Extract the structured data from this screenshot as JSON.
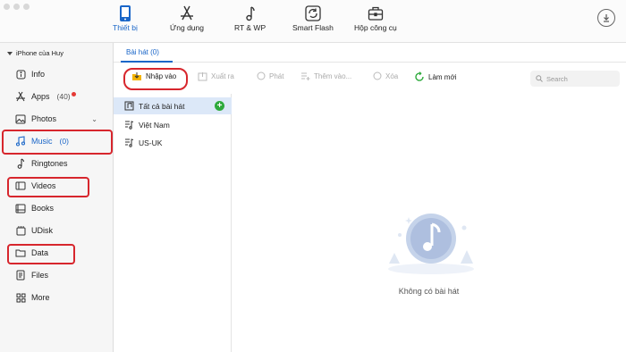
{
  "toolbar": {
    "items": [
      {
        "label": "Thiết bị",
        "icon": "phone-icon",
        "active": true
      },
      {
        "label": "Ứng dụng",
        "icon": "app-store-icon",
        "active": false
      },
      {
        "label": "RT & WP",
        "icon": "music-note-icon",
        "active": false
      },
      {
        "label": "Smart Flash",
        "icon": "refresh-icon",
        "active": false
      },
      {
        "label": "Hộp công cụ",
        "icon": "toolbox-icon",
        "active": false
      }
    ],
    "download_icon": "download-icon"
  },
  "sidebar": {
    "device_name": "iPhone của Huy",
    "items": [
      {
        "label": "Info",
        "icon": "info-icon"
      },
      {
        "label": "Apps",
        "count": "(40)",
        "icon": "apps-icon"
      },
      {
        "label": "Photos",
        "icon": "photos-icon"
      },
      {
        "label": "Music",
        "count": "(0)",
        "icon": "music-icon"
      },
      {
        "label": "Ringtones",
        "icon": "ringtone-icon"
      },
      {
        "label": "Videos",
        "icon": "video-icon"
      },
      {
        "label": "Books",
        "icon": "books-icon"
      },
      {
        "label": "UDisk",
        "icon": "udisk-icon"
      },
      {
        "label": "Data",
        "icon": "folder-icon"
      },
      {
        "label": "Files",
        "icon": "files-icon"
      },
      {
        "label": "More",
        "icon": "more-icon"
      }
    ]
  },
  "tabs": [
    {
      "label": "Bài hát (0)"
    }
  ],
  "actions": [
    {
      "label": "Nhập vào",
      "icon": "import-icon",
      "enabled": true
    },
    {
      "label": "Xuất ra",
      "icon": "export-icon",
      "enabled": false
    },
    {
      "label": "Phát",
      "icon": "play-icon",
      "enabled": false
    },
    {
      "label": "Thêm vào...",
      "icon": "add-to-icon",
      "enabled": false
    },
    {
      "label": "Xóa",
      "icon": "delete-icon",
      "enabled": false
    },
    {
      "label": "Làm mới",
      "icon": "refresh-icon",
      "enabled": true
    }
  ],
  "search": {
    "placeholder": "Search"
  },
  "playlists": [
    {
      "label": "Tất cả bài hát",
      "selected": true
    },
    {
      "label": "Việt Nam",
      "selected": false
    },
    {
      "label": "US-UK",
      "selected": false
    }
  ],
  "empty_state": {
    "message": "Không có bài hát"
  },
  "colors": {
    "accent": "#1a66c8",
    "highlight": "#d7262d",
    "add_green": "#2eaa3c"
  }
}
